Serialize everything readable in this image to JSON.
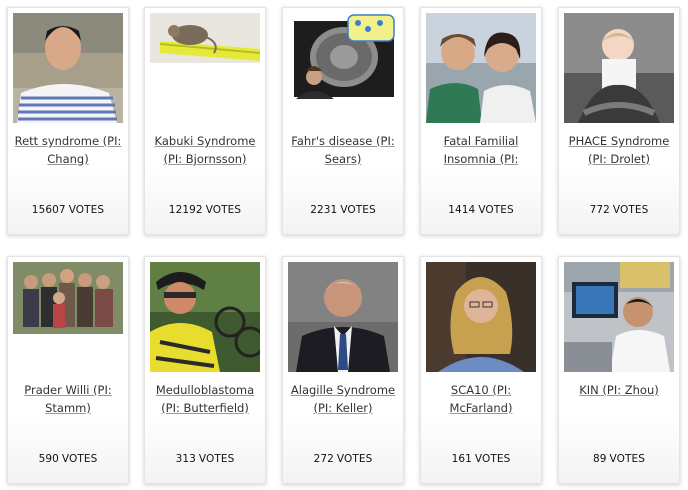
{
  "cards": [
    {
      "title": "Rett syndrome (PI: Chang)",
      "votes": "15607",
      "votes_label": "VOTES"
    },
    {
      "title": "Kabuki Syndrome (PI: Bjornsson)",
      "votes": "12192",
      "votes_label": "VOTES"
    },
    {
      "title": "Fahr's disease (PI: Sears)",
      "votes": "2231",
      "votes_label": "VOTES"
    },
    {
      "title": "Fatal Familial Insomnia (PI:",
      "votes": "1414",
      "votes_label": "VOTES"
    },
    {
      "title": "PHACE Syndrome (PI: Drolet)",
      "votes": "772",
      "votes_label": "VOTES"
    },
    {
      "title": "Prader Willi (PI: Stamm)",
      "votes": "590",
      "votes_label": "VOTES"
    },
    {
      "title": "Medulloblastoma (PI: Butterfield)",
      "votes": "313",
      "votes_label": "VOTES"
    },
    {
      "title": "Alagille Syndrome (PI: Keller)",
      "votes": "272",
      "votes_label": "VOTES"
    },
    {
      "title": "SCA10 (PI: McFarland)",
      "votes": "161",
      "votes_label": "VOTES"
    },
    {
      "title": "KIN (PI: Zhou)",
      "votes": "89",
      "votes_label": "VOTES"
    }
  ]
}
